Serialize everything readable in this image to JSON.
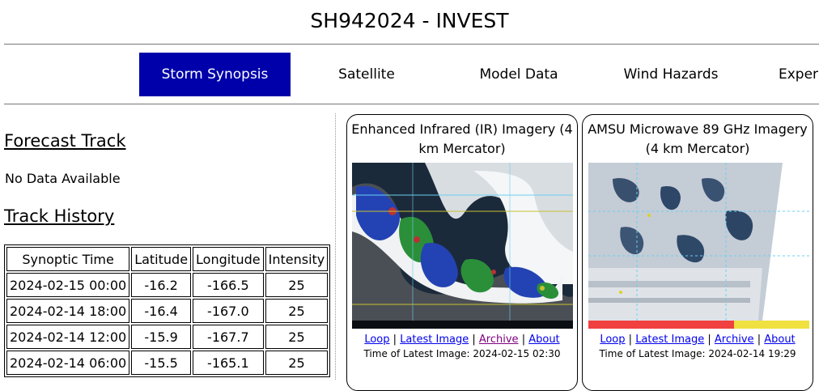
{
  "page": {
    "title": "SH942024 - INVEST"
  },
  "nav": {
    "items": [
      {
        "label": "Storm Synopsis",
        "active": true
      },
      {
        "label": "Satellite",
        "active": false
      },
      {
        "label": "Model Data",
        "active": false
      },
      {
        "label": "Wind Hazards",
        "active": false
      },
      {
        "label": "Experi",
        "active": false
      }
    ]
  },
  "forecast": {
    "heading": "Forecast Track",
    "message": "No Data Available"
  },
  "history": {
    "heading": "Track History",
    "columns": [
      "Synoptic Time",
      "Latitude",
      "Longitude",
      "Intensity"
    ],
    "rows": [
      [
        "2024-02-15 00:00",
        "-16.2",
        "-166.5",
        "25"
      ],
      [
        "2024-02-14 18:00",
        "-16.4",
        "-167.0",
        "25"
      ],
      [
        "2024-02-14 12:00",
        "-15.9",
        "-167.7",
        "25"
      ],
      [
        "2024-02-14 06:00",
        "-15.5",
        "-165.1",
        "25"
      ]
    ]
  },
  "panels": [
    {
      "title": "Enhanced Infrared (IR) Imagery (4 km Mercator)",
      "links": {
        "loop": "Loop",
        "latest": "Latest Image",
        "archive": "Archive",
        "about": "About"
      },
      "latest_label": "Time of Latest Image:",
      "latest_value": "2024-02-15 02:30"
    },
    {
      "title": "AMSU Microwave 89 GHz Imagery (4 km Mercator)",
      "links": {
        "loop": "Loop",
        "latest": "Latest Image",
        "archive": "Archive",
        "about": "About"
      },
      "latest_label": "Time of Latest Image:",
      "latest_value": "2024-02-14 19:29"
    }
  ],
  "colors": {
    "nav_active_bg": "#0000aa",
    "link": "#0000ee",
    "visited_link": "#800080"
  }
}
